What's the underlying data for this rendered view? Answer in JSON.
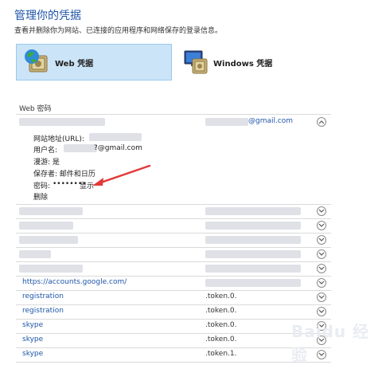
{
  "header": {
    "title": "管理你的凭据",
    "subtitle": "查看并删除你为网站、已连接的应用程序和网络保存的登录信息。"
  },
  "tabs": [
    {
      "label": "Web 凭据",
      "icon": "web-credentials-globe-safe-icon",
      "selected": true
    },
    {
      "label": "Windows 凭据",
      "icon": "windows-credentials-monitor-safe-icon",
      "selected": false
    }
  ],
  "section": {
    "title": "Web 密码"
  },
  "expanded": {
    "account": "@gmail.com",
    "url_label": "网站地址(URL):",
    "username_label": "用户名:",
    "username_value": "?@gmail.com",
    "roaming": "漫游: 是",
    "saved_by": "保存者:  邮件和日历",
    "password_label": "密码:",
    "password_mask": "••••••••",
    "show_link": "显示",
    "delete_link": "删除"
  },
  "rows": [
    {
      "site": "",
      "account": ""
    },
    {
      "site": "",
      "account": ""
    },
    {
      "site": "",
      "account": ""
    },
    {
      "site": "",
      "account": ""
    },
    {
      "site": "",
      "account": ""
    },
    {
      "site": "https://accounts.google.com/",
      "account": ""
    },
    {
      "site": "registration",
      "account": ".token.0."
    },
    {
      "site": "registration",
      "account": ".token.0."
    },
    {
      "site": "skype",
      "account": ".token.0."
    },
    {
      "site": "skype",
      "account": ".token.0."
    },
    {
      "site": "skype",
      "account": ".token.1."
    }
  ],
  "watermark": "Baidu 经验",
  "colors": {
    "accent": "#1f56a8",
    "selected_tab_bg": "#cce4f7",
    "annotation_arrow": "#e23a3a"
  }
}
